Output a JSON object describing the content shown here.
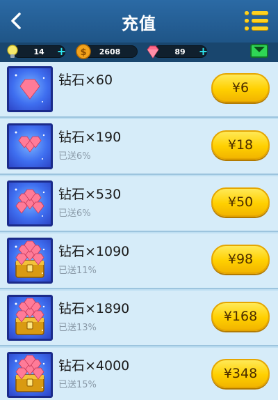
{
  "header": {
    "title": "充值"
  },
  "resources": {
    "bulb": {
      "value": "14",
      "color": "#f6e86b"
    },
    "coin": {
      "value": "2608",
      "color": "#f2a31c"
    },
    "diamond": {
      "value": "89",
      "color": "#ff6a8a"
    }
  },
  "items": [
    {
      "name": "钻石×60",
      "bonus": "",
      "price": "¥6"
    },
    {
      "name": "钻石×190",
      "bonus": "已送6%",
      "price": "¥18"
    },
    {
      "name": "钻石×530",
      "bonus": "已送6%",
      "price": "¥50"
    },
    {
      "name": "钻石×1090",
      "bonus": "已送11%",
      "price": "¥98"
    },
    {
      "name": "钻石×1890",
      "bonus": "已送13%",
      "price": "¥168"
    },
    {
      "name": "钻石×4000",
      "bonus": "已送15%",
      "price": "¥348"
    }
  ],
  "colors": {
    "header": "#2b6aa5",
    "list_bg": "#d6ecf9",
    "button": "#ffd000"
  }
}
